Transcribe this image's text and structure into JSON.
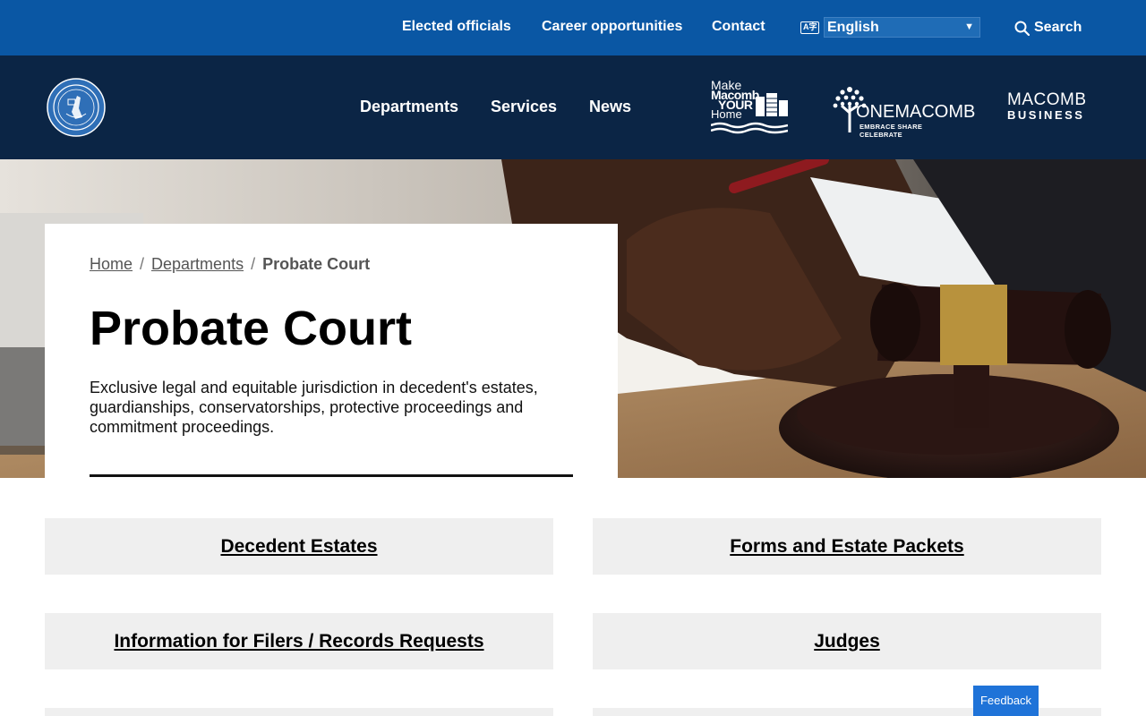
{
  "utility_nav": {
    "elected_officials": "Elected officials",
    "career_opportunities": "Career opportunities",
    "contact": "Contact",
    "language_icon_text": "A字",
    "language_selected": "English",
    "search_label": "Search"
  },
  "main_nav": {
    "departments": "Departments",
    "services": "Services",
    "news": "News"
  },
  "partner_logos": {
    "make_macomb": {
      "line1": "Make",
      "line2": "Macomb",
      "line3": "YOUR",
      "line4": "Home"
    },
    "one_macomb": {
      "wordmark": "ONEMACOMB",
      "tagline": "EMBRACE SHARE CELEBRATE"
    },
    "macomb_business": {
      "line1": "MACOMB",
      "line2": "BUSINESS"
    }
  },
  "breadcrumb": {
    "home": "Home",
    "separator": "/",
    "departments": "Departments",
    "current": "Probate Court"
  },
  "page": {
    "title": "Probate Court",
    "description": "Exclusive legal and equitable jurisdiction in decedent's estates, guardianships, conservatorships, protective proceedings and commitment proceedings."
  },
  "tiles": [
    {
      "label": "Decedent Estates"
    },
    {
      "label": "Forms and Estate Packets"
    },
    {
      "label": "Information for Filers / Records Requests"
    },
    {
      "label": "Judges"
    }
  ],
  "feedback": {
    "label": "Feedback"
  },
  "colors": {
    "utility_bar": "#0a57a4",
    "header": "#0b2545",
    "tile_bg": "#efefef",
    "feedback": "#1f73d8"
  }
}
